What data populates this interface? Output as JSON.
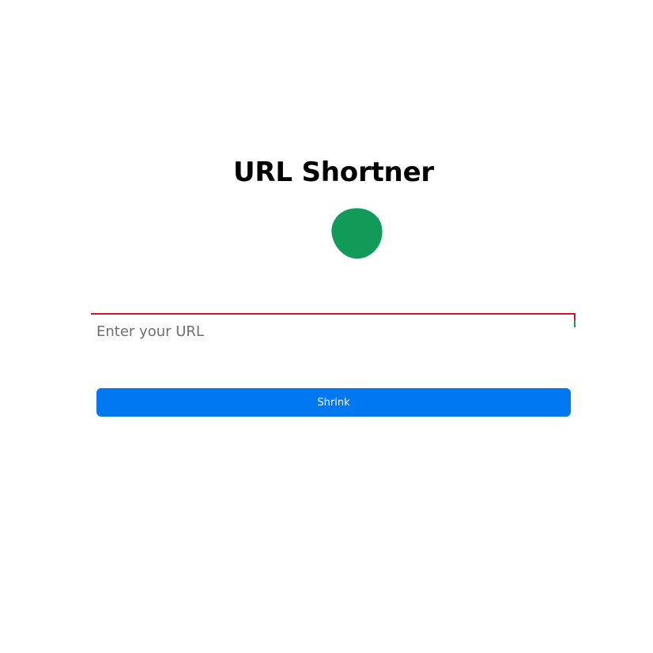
{
  "header": {
    "title": "URL Shortner"
  },
  "loader": {
    "icon": "green-blob-icon",
    "color": "#129a58"
  },
  "form": {
    "url_input": {
      "value": "",
      "placeholder": "Enter your URL"
    },
    "submit_label": "Shrink"
  },
  "colors": {
    "button": "#0277f2",
    "border_error": "#d4142c",
    "border_ok": "#14a33a"
  }
}
